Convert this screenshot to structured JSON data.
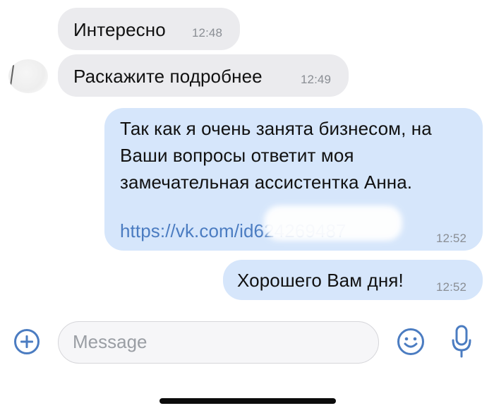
{
  "messages": [
    {
      "text": "Интересно",
      "time": "12:48"
    },
    {
      "text": "Раскажите подробнее",
      "time": "12:49"
    },
    {
      "lines": [
        "Так как я очень занята бизнесом, на",
        "Ваши вопросы ответит моя",
        "замечательная ассистентка Анна."
      ],
      "link": "https://vk.com/id624269487",
      "time": "12:52"
    },
    {
      "text": "Хорошего Вам дня!",
      "time": "12:52"
    }
  ],
  "composer": {
    "placeholder": "Message"
  },
  "icons": {
    "attach": "plus-circle-icon",
    "emoji": "smile-icon",
    "voice": "microphone-icon"
  },
  "colors": {
    "incoming_bubble": "#ebebee",
    "outgoing_bubble": "#d6e6fb",
    "accent": "#4b7cc1",
    "time": "#8a8e94"
  }
}
